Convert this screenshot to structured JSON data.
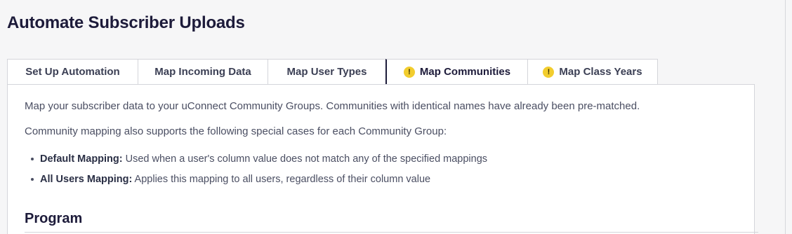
{
  "page": {
    "title": "Automate Subscriber Uploads"
  },
  "tabs": [
    {
      "label": "Set Up Automation",
      "warning": false,
      "active": false
    },
    {
      "label": "Map Incoming Data",
      "warning": false,
      "active": false
    },
    {
      "label": "Map User Types",
      "warning": false,
      "active": false
    },
    {
      "label": "Map Communities",
      "warning": true,
      "active": true
    },
    {
      "label": "Map Class Years",
      "warning": true,
      "active": false
    }
  ],
  "warning_glyph": "!",
  "panel": {
    "intro": "Map your subscriber data to your uConnect Community Groups. Communities with identical names have already been pre-matched.",
    "intro2": "Community mapping also supports the following special cases for each Community Group:",
    "bullets": [
      {
        "term": "Default Mapping:",
        "text": " Used when a user's column value does not match any of the specified mappings"
      },
      {
        "term": "All Users Mapping:",
        "text": " Applies this mapping to all users, regardless of their column value"
      }
    ],
    "section_title": "Program"
  },
  "colors": {
    "warning": "#f2cd2e",
    "title": "#1d1b3a",
    "border": "#d4d5da"
  }
}
